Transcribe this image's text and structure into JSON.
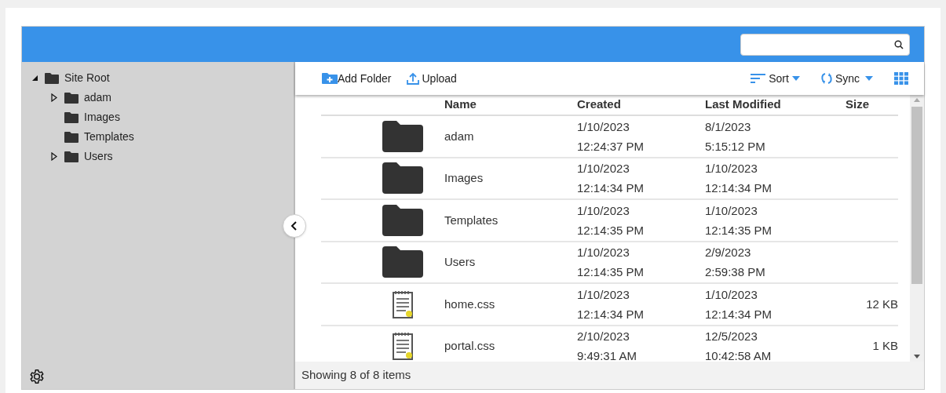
{
  "tree": [
    {
      "label": "Site Root",
      "expanded": true,
      "children": [
        {
          "label": "adam",
          "expanded": false
        },
        {
          "label": "Images"
        },
        {
          "label": "Templates"
        },
        {
          "label": "Users",
          "expanded": false
        }
      ]
    }
  ],
  "toolbar": {
    "add_folder": "Add Folder",
    "upload": "Upload",
    "sort": "Sort",
    "sync": "Sync"
  },
  "table": {
    "columns": [
      "Name",
      "Created",
      "Last Modified",
      "Size"
    ],
    "rows": [
      {
        "kind": "folder",
        "name": "adam",
        "created": [
          "1/10/2023",
          "12:24:37 PM"
        ],
        "modified": [
          "8/1/2023",
          "5:15:12 PM"
        ]
      },
      {
        "kind": "folder",
        "name": "Images",
        "created": [
          "1/10/2023",
          "12:14:34 PM"
        ],
        "modified": [
          "1/10/2023",
          "12:14:34 PM"
        ]
      },
      {
        "kind": "folder",
        "name": "Templates",
        "created": [
          "1/10/2023",
          "12:14:35 PM"
        ],
        "modified": [
          "1/10/2023",
          "12:14:35 PM"
        ]
      },
      {
        "kind": "folder",
        "name": "Users",
        "created": [
          "1/10/2023",
          "12:14:35 PM"
        ],
        "modified": [
          "2/9/2023",
          "2:59:38 PM"
        ]
      },
      {
        "kind": "file",
        "name": "home.css",
        "created": [
          "1/10/2023",
          "12:14:34 PM"
        ],
        "modified": [
          "1/10/2023",
          "12:14:34 PM"
        ],
        "size": "12 KB"
      },
      {
        "kind": "file",
        "name": "portal.css",
        "created": [
          "2/10/2023",
          "9:49:31 AM"
        ],
        "modified": [
          "12/5/2023",
          "10:42:58 AM"
        ],
        "size": "1 KB"
      }
    ]
  },
  "status_bar": "Showing 8 of 8 items"
}
